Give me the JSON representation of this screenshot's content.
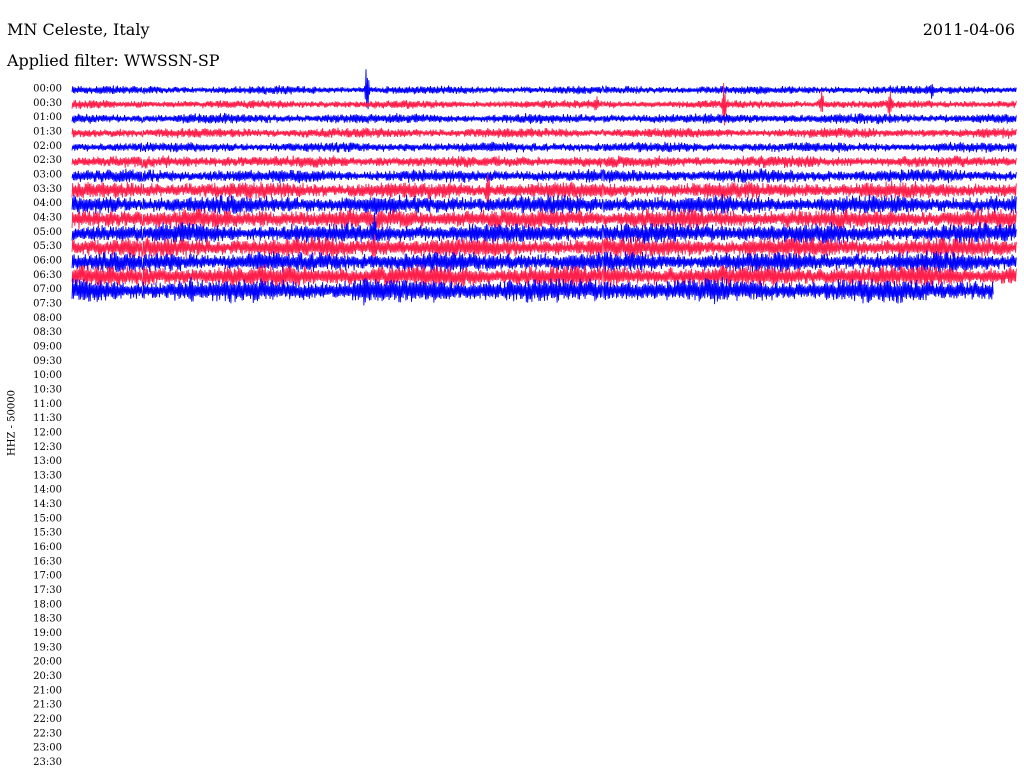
{
  "header": {
    "station": "MN Celeste, Italy",
    "date": "2011-04-06",
    "filter": "Applied filter: WWSSN-SP",
    "channel": "HHZ - 50000"
  },
  "chart_data": {
    "type": "line",
    "title": "MN Celeste, Italy",
    "ylabel": "HHZ - 50000",
    "colors": [
      "#0000ff",
      "#ff1f4b"
    ],
    "rows": [
      {
        "label": "00:00",
        "color": "#0000ff",
        "amplitude": 5,
        "end_fraction": 1.0,
        "spikes": [
          [
            0.312,
            30
          ],
          [
            0.91,
            8
          ]
        ]
      },
      {
        "label": "00:30",
        "color": "#ff1f4b",
        "amplitude": 5,
        "end_fraction": 1.0,
        "spikes": [
          [
            0.69,
            22
          ],
          [
            0.865,
            14
          ],
          [
            0.793,
            15
          ],
          [
            0.555,
            10
          ]
        ]
      },
      {
        "label": "01:00",
        "color": "#0000ff",
        "amplitude": 6,
        "end_fraction": 1.0,
        "spikes": []
      },
      {
        "label": "01:30",
        "color": "#ff1f4b",
        "amplitude": 6,
        "end_fraction": 1.0,
        "spikes": []
      },
      {
        "label": "02:00",
        "color": "#0000ff",
        "amplitude": 6,
        "end_fraction": 1.0,
        "spikes": []
      },
      {
        "label": "02:30",
        "color": "#ff1f4b",
        "amplitude": 7,
        "end_fraction": 1.0,
        "spikes": []
      },
      {
        "label": "03:00",
        "color": "#0000ff",
        "amplitude": 8,
        "end_fraction": 1.0,
        "spikes": []
      },
      {
        "label": "03:30",
        "color": "#ff1f4b",
        "amplitude": 10,
        "end_fraction": 1.0,
        "spikes": [
          [
            0.44,
            14
          ]
        ]
      },
      {
        "label": "04:00",
        "color": "#0000ff",
        "amplitude": 11,
        "end_fraction": 1.0,
        "spikes": []
      },
      {
        "label": "04:30",
        "color": "#ff1f4b",
        "amplitude": 12,
        "end_fraction": 1.0,
        "spikes": []
      },
      {
        "label": "05:00",
        "color": "#0000ff",
        "amplitude": 12,
        "end_fraction": 1.0,
        "spikes": [
          [
            0.32,
            18
          ]
        ]
      },
      {
        "label": "05:30",
        "color": "#ff1f4b",
        "amplitude": 12,
        "end_fraction": 1.0,
        "spikes": [
          [
            0.32,
            16
          ]
        ]
      },
      {
        "label": "06:00",
        "color": "#0000ff",
        "amplitude": 12,
        "end_fraction": 1.0,
        "spikes": []
      },
      {
        "label": "06:30",
        "color": "#ff1f4b",
        "amplitude": 13,
        "end_fraction": 1.0,
        "spikes": []
      },
      {
        "label": "07:00",
        "color": "#0000ff",
        "amplitude": 14,
        "end_fraction": 0.975,
        "spikes": [
          [
            0.31,
            26
          ],
          [
            0.127,
            14
          ]
        ]
      }
    ],
    "y_tick_labels": [
      "00:00",
      "00:30",
      "01:00",
      "01:30",
      "02:00",
      "02:30",
      "03:00",
      "03:30",
      "04:00",
      "04:30",
      "05:00",
      "05:30",
      "06:00",
      "06:30",
      "07:00",
      "07:30",
      "08:00",
      "08:30",
      "09:00",
      "09:30",
      "10:00",
      "10:30",
      "11:00",
      "11:30",
      "12:00",
      "12:30",
      "13:00",
      "13:30",
      "14:00",
      "14:30",
      "15:00",
      "15:30",
      "16:00",
      "16:30",
      "17:00",
      "17:30",
      "18:00",
      "18:30",
      "19:00",
      "19:30",
      "20:00",
      "20:30",
      "21:00",
      "21:30",
      "22:00",
      "22:30",
      "23:00",
      "23:30"
    ],
    "x_tick_labels": []
  }
}
